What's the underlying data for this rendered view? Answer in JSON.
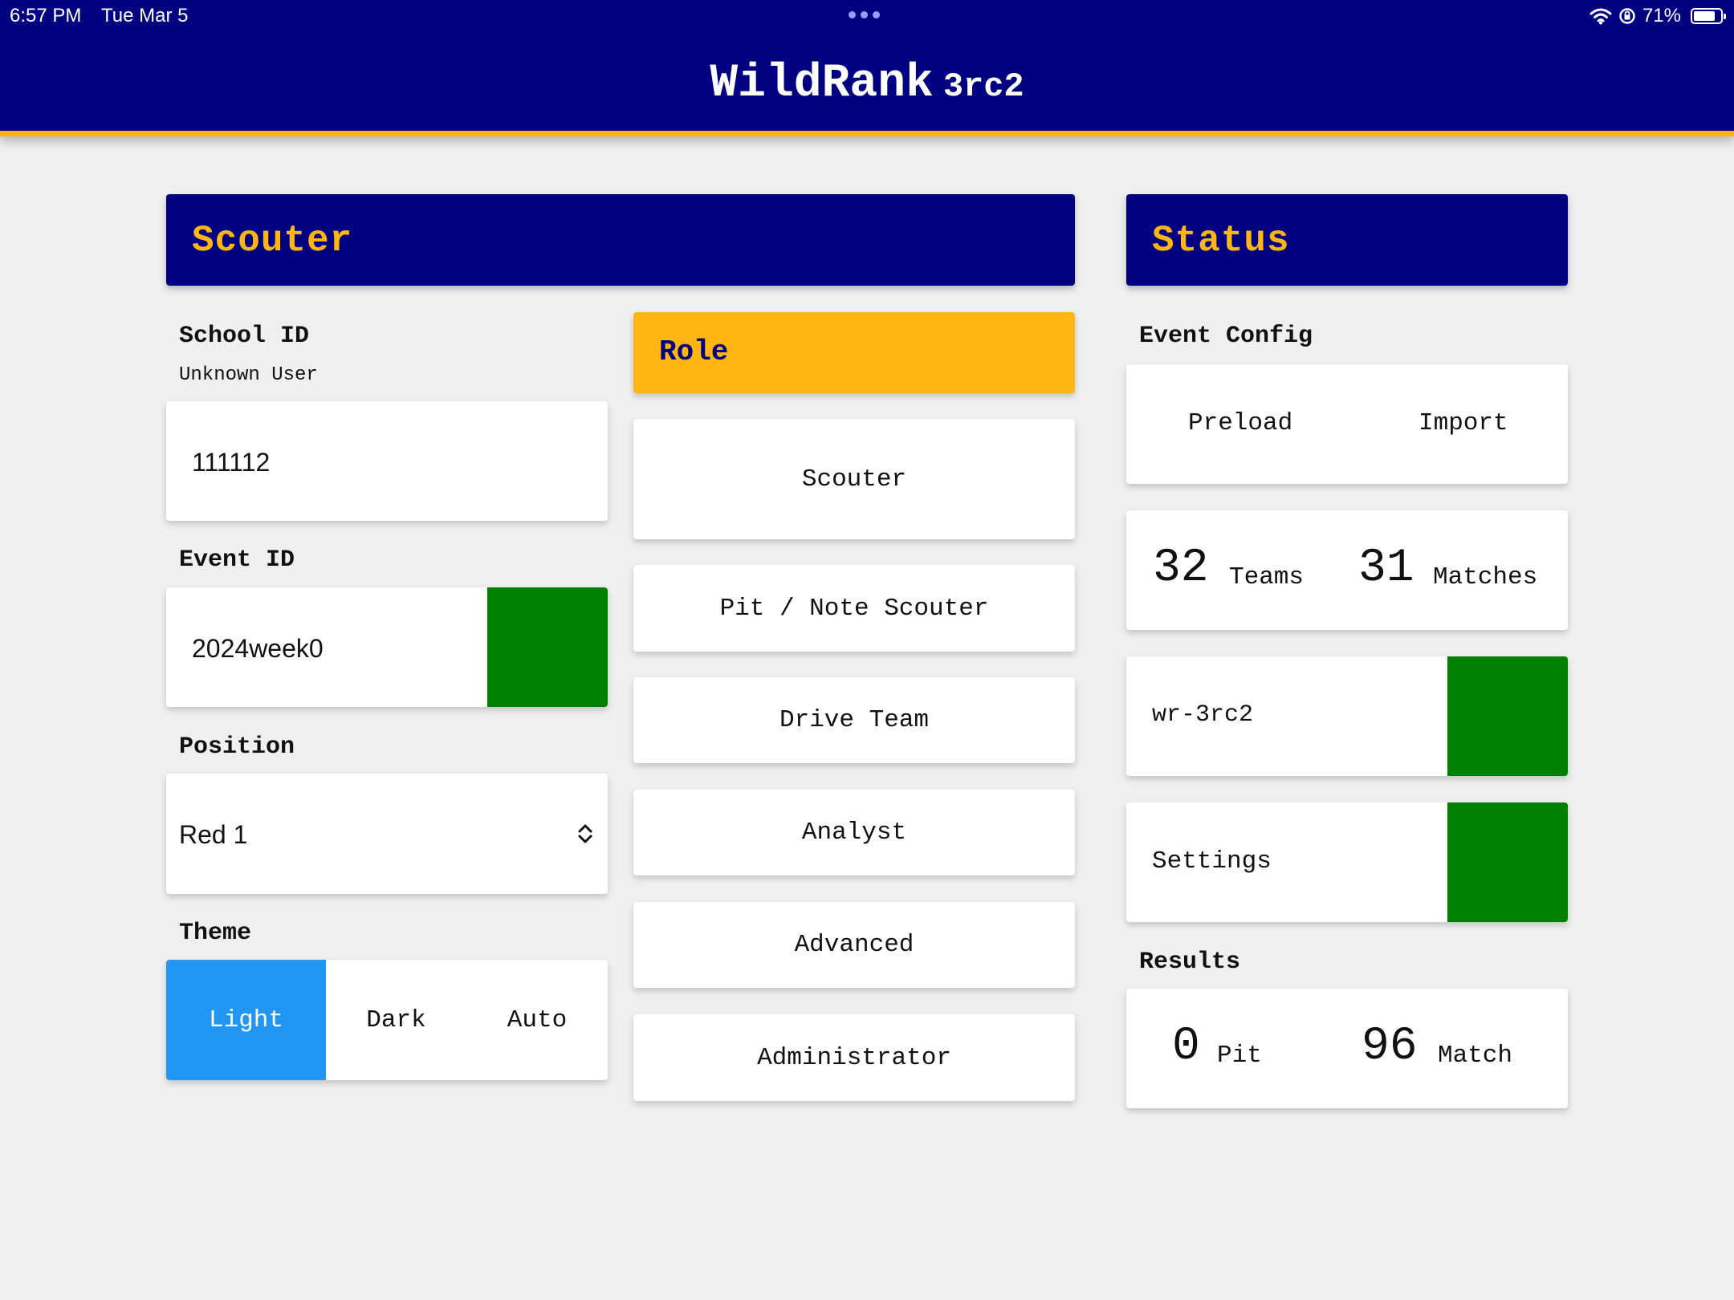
{
  "status_bar": {
    "time": "6:57 PM",
    "date": "Tue Mar 5",
    "battery": "71%"
  },
  "app": {
    "title": "WildRank",
    "version": "3rc2"
  },
  "scouter_panel": {
    "heading": "Scouter",
    "school_id": {
      "label": "School ID",
      "user": "Unknown User",
      "value": "111112"
    },
    "event_id": {
      "label": "Event ID",
      "value": "2024week0",
      "status_color": "#008000"
    },
    "position": {
      "label": "Position",
      "value": "Red 1"
    },
    "theme": {
      "label": "Theme",
      "options": [
        "Light",
        "Dark",
        "Auto"
      ],
      "selected": "Light"
    }
  },
  "role_panel": {
    "heading": "Role",
    "buttons": [
      "Scouter",
      "Pit / Note Scouter",
      "Drive Team",
      "Analyst",
      "Advanced",
      "Administrator"
    ]
  },
  "status_panel": {
    "heading": "Status",
    "event_config": {
      "label": "Event Config",
      "preload": "Preload",
      "import": "Import"
    },
    "counts": {
      "teams": "32",
      "teams_label": "Teams",
      "matches": "31",
      "matches_label": "Matches"
    },
    "cache": {
      "label": "wr-3rc2",
      "status_color": "#008000"
    },
    "settings": {
      "label": "Settings",
      "status_color": "#008000"
    },
    "results": {
      "label": "Results",
      "pit": "0",
      "pit_label": "Pit",
      "match": "96",
      "match_label": "Match"
    }
  },
  "colors": {
    "primary": "#000080",
    "accent": "#ffb612",
    "ok": "#008000",
    "selected": "#2196f3"
  }
}
